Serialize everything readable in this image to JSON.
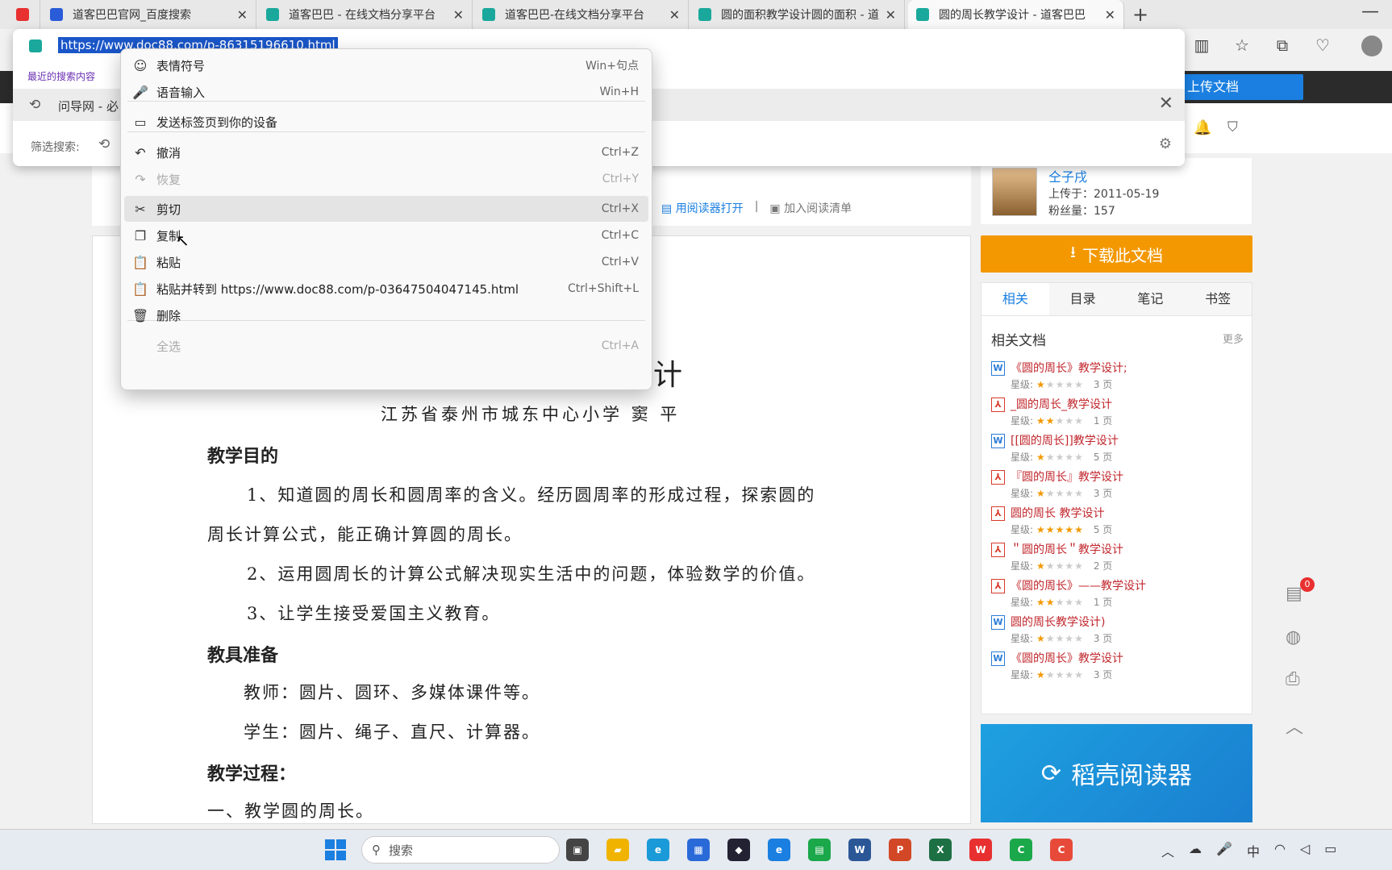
{
  "tabs": [
    {
      "title": "",
      "favicon_color": "#e83030",
      "active": false
    },
    {
      "title": "道客巴巴官网_百度搜索",
      "favicon_color": "#2a5bd8",
      "active": false
    },
    {
      "title": "道客巴巴 - 在线文档分享平台",
      "favicon_color": "#1aa89c",
      "active": false
    },
    {
      "title": "道客巴巴-在线文档分享平台",
      "favicon_color": "#1aa89c",
      "active": false
    },
    {
      "title": "圆的面积教学设计圆的面积 - 道客",
      "favicon_color": "#1aa89c",
      "active": false
    },
    {
      "title": "圆的周长教学设计 - 道客巴巴",
      "favicon_color": "#1aa89c",
      "active": true
    }
  ],
  "address_bar": {
    "url": "https://www.doc88.com/p-86315196610.html",
    "recent_label": "最近的搜索内容",
    "history_item": "问导网 - 必",
    "filter_label": "筛选搜索:"
  },
  "site": {
    "upload_label": "上传文档",
    "doc_actions": [
      "用阅读器打开",
      "加入阅读清单"
    ]
  },
  "context_menu": {
    "items": [
      {
        "icon": "☺",
        "label": "表情符号",
        "shortcut": "Win+句点",
        "disabled": false
      },
      {
        "icon": "🎤",
        "label": "语音输入",
        "shortcut": "Win+H",
        "disabled": false
      },
      {
        "icon": "▭",
        "label": "发送标签页到你的设备",
        "shortcut": "",
        "disabled": false
      },
      {
        "icon": "↶",
        "label": "撤消",
        "shortcut": "Ctrl+Z",
        "disabled": false
      },
      {
        "icon": "↷",
        "label": "恢复",
        "shortcut": "Ctrl+Y",
        "disabled": true
      },
      {
        "icon": "✂",
        "label": "剪切",
        "shortcut": "Ctrl+X",
        "disabled": false,
        "hover": true
      },
      {
        "icon": "❐",
        "label": "复制",
        "shortcut": "Ctrl+C",
        "disabled": false
      },
      {
        "icon": "📋",
        "label": "粘贴",
        "shortcut": "Ctrl+V",
        "disabled": false
      },
      {
        "icon": "📋",
        "label": "粘贴并转到 https://www.doc88.com/p-03647504047145.html",
        "shortcut": "Ctrl+Shift+L",
        "disabled": false
      },
      {
        "icon": "🗑",
        "label": "删除",
        "shortcut": "",
        "disabled": false
      },
      {
        "icon": "",
        "label": "全选",
        "shortcut": "Ctrl+A",
        "disabled": true
      }
    ]
  },
  "document": {
    "title_fragment": "计",
    "author_line": "江苏省泰州市城东中心小学 窦 平",
    "heading_goals": "教学目的",
    "goal1a": "1、知道圆的周长和圆周率的含义。经历圆周率的形成过程，探索圆的",
    "goal1b": "周长计算公式，能正确计算圆的周长。",
    "goal2": "2、运用圆周长的计算公式解决现实生活中的问题，体验数学的价值。",
    "goal3": "3、让学生接受爱国主义教育。",
    "heading_tools": "教具准备",
    "tools_teacher": "教师：圆片、圆环、多媒体课件等。",
    "tools_student": "学生：圆片、绳子、直尺、计算器。",
    "heading_process": "教学过程：",
    "process1": "一、教学圆的周长。"
  },
  "sidebar": {
    "author_name": "仝子戌",
    "upload_date": "上传于：2011-05-19",
    "fans": "粉丝量：157",
    "download_label": "下载此文档",
    "tabs": [
      "相关",
      "目录",
      "笔记",
      "书签"
    ],
    "related_title": "相关文档",
    "more_label": "更多",
    "rating_label": "星级:",
    "related": [
      {
        "type": "w",
        "title": "《圆的周长》教学设计;",
        "stars": 1,
        "pages": "3 页"
      },
      {
        "type": "p",
        "title": "_圆的周长_教学设计",
        "stars": 2,
        "pages": "1 页"
      },
      {
        "type": "w",
        "title": "[[圆的周长]]教学设计",
        "stars": 1,
        "pages": "5 页"
      },
      {
        "type": "p",
        "title": "『圆的周长』教学设计",
        "stars": 1,
        "pages": "3 页"
      },
      {
        "type": "p",
        "title": "圆的周长 教学设计",
        "stars": 5,
        "pages": "5 页"
      },
      {
        "type": "p",
        "title": "＂圆的周长＂教学设计",
        "stars": 1,
        "pages": "2 页"
      },
      {
        "type": "p",
        "title": "《圆的周长》——教学设计",
        "stars": 2,
        "pages": "1 页"
      },
      {
        "type": "w",
        "title": "圆的周长教学设计)",
        "stars": 1,
        "pages": "3 页"
      },
      {
        "type": "w",
        "title": "《圆的周长》教学设计",
        "stars": 1,
        "pages": "3 页"
      }
    ],
    "banner_text": "稻壳阅读器",
    "badge_count": "0"
  },
  "taskbar": {
    "search_placeholder": "搜索",
    "ime_label": "中"
  }
}
